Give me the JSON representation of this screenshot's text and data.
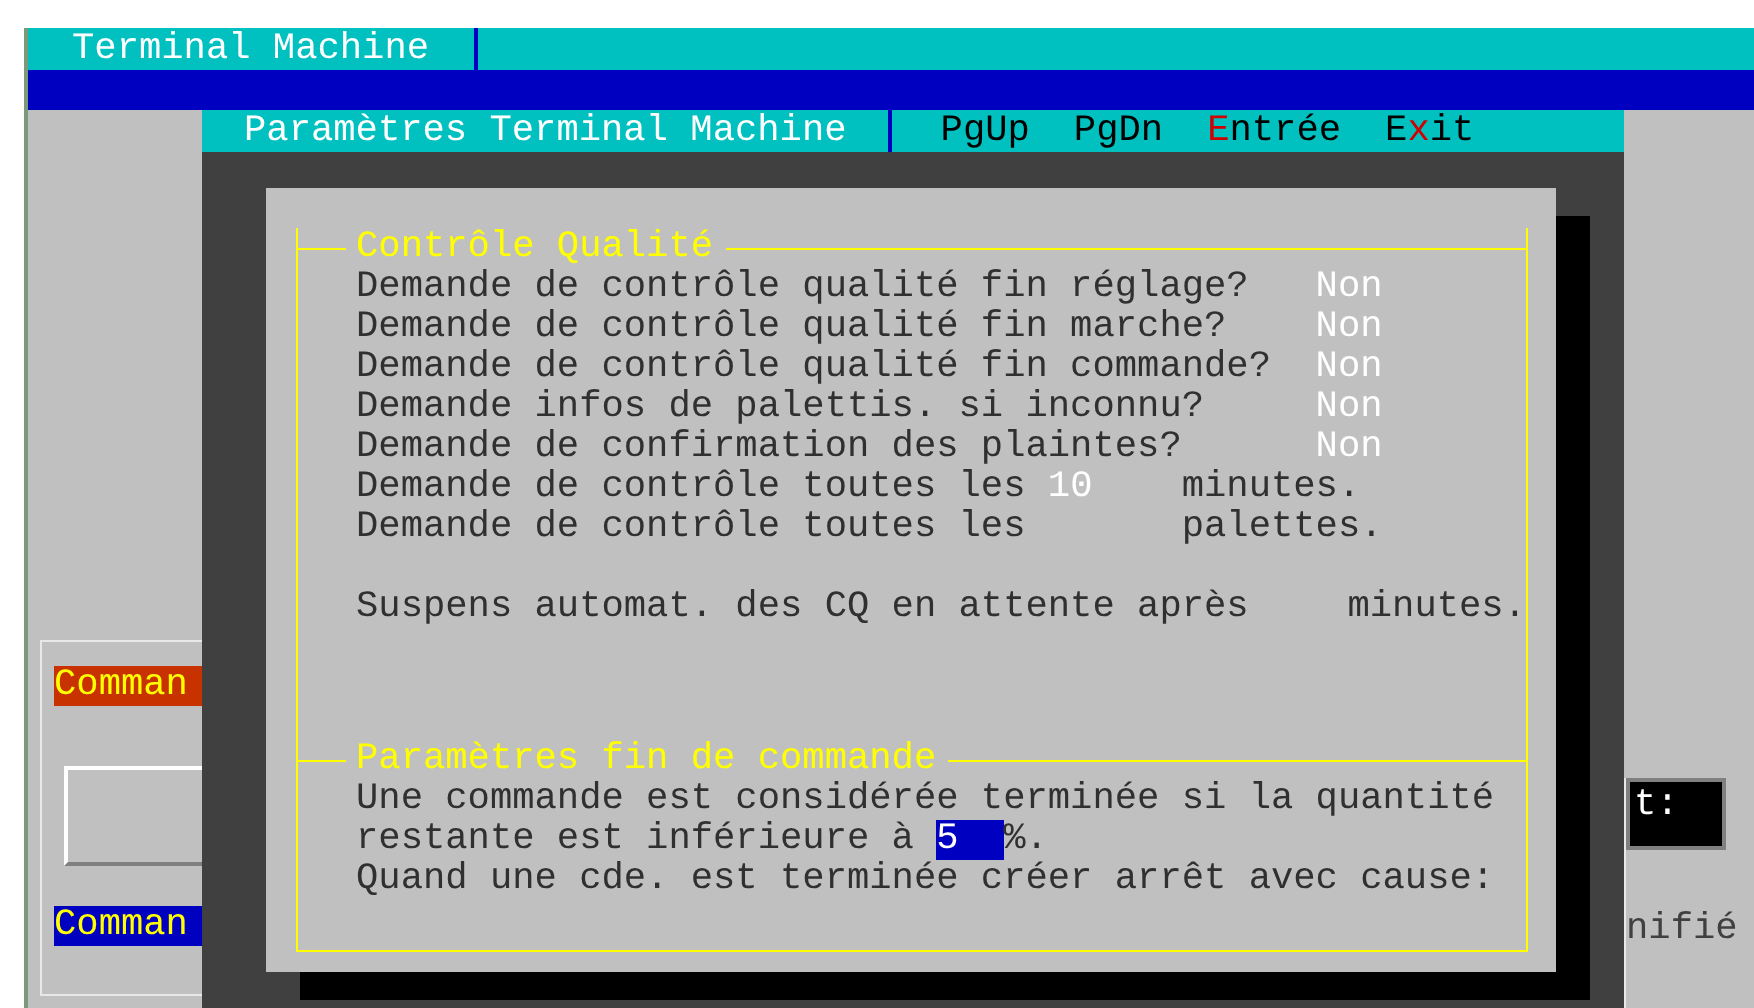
{
  "window": {
    "title": "Terminal Machine"
  },
  "background": {
    "labels": [
      {
        "text": "Comman",
        "color": "#c83200"
      },
      {
        "text": "Comman",
        "color": "#0000c0"
      }
    ],
    "field_label": "t:",
    "text": "nifié"
  },
  "dialog": {
    "title": "Paramètres Terminal Machine",
    "keys": [
      {
        "before": "PgUp"
      },
      {
        "before": "PgDn"
      },
      {
        "hotkey": "E",
        "after": "ntrée"
      },
      {
        "before": "E",
        "hotkey": "x",
        "after": "it"
      }
    ],
    "quality": {
      "title": "Contrôle Qualité",
      "questions": [
        {
          "label": "Demande de contrôle qualité fin réglage?",
          "value": "Non"
        },
        {
          "label": "Demande de contrôle qualité fin marche?",
          "value": "Non"
        },
        {
          "label": "Demande de contrôle qualité fin commande?",
          "value": "Non"
        },
        {
          "label": "Demande infos de palettis. si inconnu?",
          "value": "Non"
        },
        {
          "label": "Demande de confirmation des plaintes?",
          "value": "Non"
        }
      ],
      "intervals": [
        {
          "before": "Demande de contrôle toutes les",
          "value": "10",
          "after": "minutes."
        },
        {
          "before": "Demande de contrôle toutes les",
          "after": "palettes."
        }
      ],
      "suspend": {
        "before": "Suspens automat. des CQ en attente après",
        "after": "minutes."
      }
    },
    "end_of_order": {
      "title": "Paramètres fin de commande",
      "line_1": "Une commande est considérée terminée si la quantité",
      "threshold": {
        "before": "restante est inférieure à",
        "value": "5",
        "after": "%.",
        "focused": true
      },
      "line_3": "Quand une cde. est terminée créer arrêt avec cause:"
    }
  }
}
